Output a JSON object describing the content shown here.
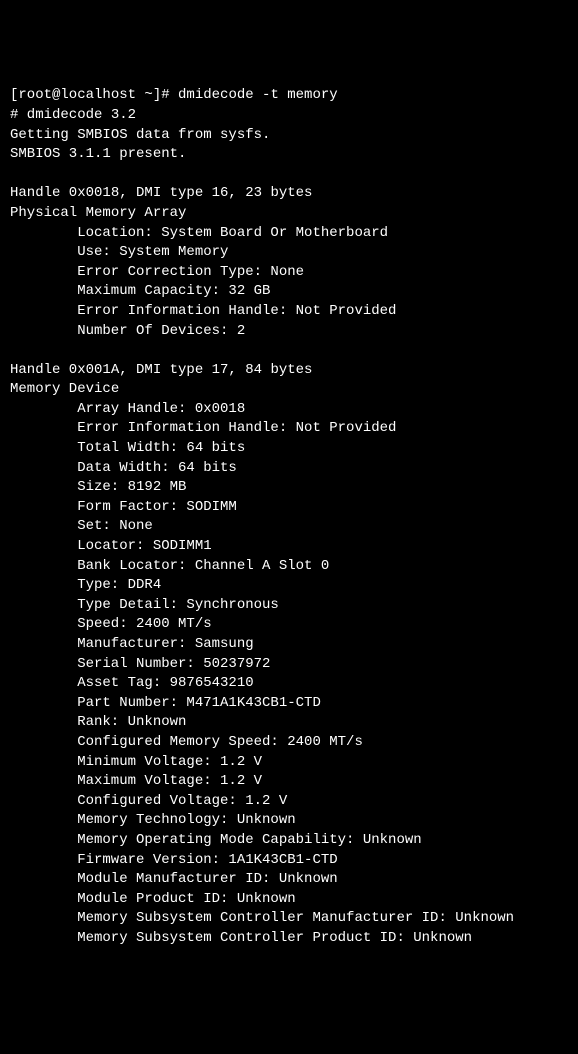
{
  "prompt": "[root@localhost ~]# ",
  "command": "dmidecode -t memory",
  "header": [
    "# dmidecode 3.2",
    "Getting SMBIOS data from sysfs.",
    "SMBIOS 3.1.1 present."
  ],
  "handle1_title": "Handle 0x0018, DMI type 16, 23 bytes",
  "handle1_name": "Physical Memory Array",
  "handle1_fields": [
    "Location: System Board Or Motherboard",
    "Use: System Memory",
    "Error Correction Type: None",
    "Maximum Capacity: 32 GB",
    "Error Information Handle: Not Provided",
    "Number Of Devices: 2"
  ],
  "handle2_title": "Handle 0x001A, DMI type 17, 84 bytes",
  "handle2_name": "Memory Device",
  "handle2_fields": [
    "Array Handle: 0x0018",
    "Error Information Handle: Not Provided",
    "Total Width: 64 bits",
    "Data Width: 64 bits",
    "Size: 8192 MB",
    "Form Factor: SODIMM",
    "Set: None",
    "Locator: SODIMM1",
    "Bank Locator: Channel A Slot 0",
    "Type: DDR4",
    "Type Detail: Synchronous",
    "Speed: 2400 MT/s",
    "Manufacturer: Samsung",
    "Serial Number: 50237972",
    "Asset Tag: 9876543210",
    "Part Number: M471A1K43CB1-CTD",
    "Rank: Unknown",
    "Configured Memory Speed: 2400 MT/s",
    "Minimum Voltage: 1.2 V",
    "Maximum Voltage: 1.2 V",
    "Configured Voltage: 1.2 V",
    "Memory Technology: Unknown",
    "Memory Operating Mode Capability: Unknown",
    "Firmware Version: 1A1K43CB1-CTD",
    "Module Manufacturer ID: Unknown",
    "Module Product ID: Unknown",
    "Memory Subsystem Controller Manufacturer ID: Unknown",
    "Memory Subsystem Controller Product ID: Unknown"
  ]
}
